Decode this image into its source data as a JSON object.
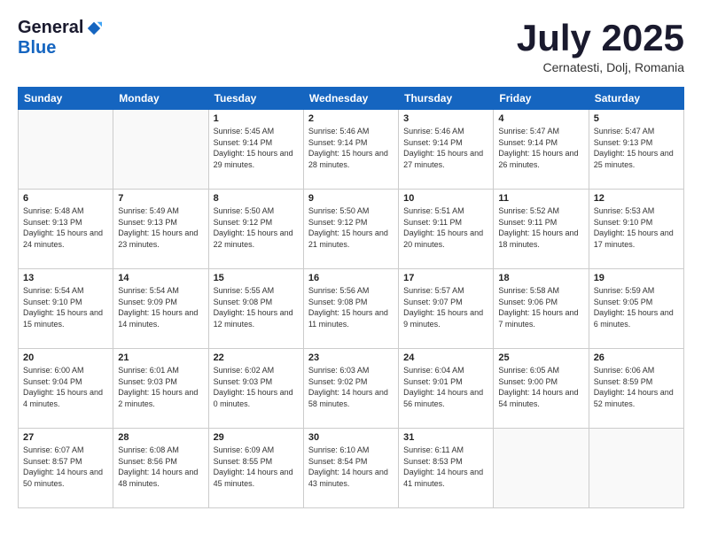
{
  "logo": {
    "general": "General",
    "blue": "Blue"
  },
  "title": "July 2025",
  "location": "Cernatesti, Dolj, Romania",
  "days_of_week": [
    "Sunday",
    "Monday",
    "Tuesday",
    "Wednesday",
    "Thursday",
    "Friday",
    "Saturday"
  ],
  "weeks": [
    [
      {
        "day": "",
        "info": ""
      },
      {
        "day": "",
        "info": ""
      },
      {
        "day": "1",
        "info": "Sunrise: 5:45 AM\nSunset: 9:14 PM\nDaylight: 15 hours and 29 minutes."
      },
      {
        "day": "2",
        "info": "Sunrise: 5:46 AM\nSunset: 9:14 PM\nDaylight: 15 hours and 28 minutes."
      },
      {
        "day": "3",
        "info": "Sunrise: 5:46 AM\nSunset: 9:14 PM\nDaylight: 15 hours and 27 minutes."
      },
      {
        "day": "4",
        "info": "Sunrise: 5:47 AM\nSunset: 9:14 PM\nDaylight: 15 hours and 26 minutes."
      },
      {
        "day": "5",
        "info": "Sunrise: 5:47 AM\nSunset: 9:13 PM\nDaylight: 15 hours and 25 minutes."
      }
    ],
    [
      {
        "day": "6",
        "info": "Sunrise: 5:48 AM\nSunset: 9:13 PM\nDaylight: 15 hours and 24 minutes."
      },
      {
        "day": "7",
        "info": "Sunrise: 5:49 AM\nSunset: 9:13 PM\nDaylight: 15 hours and 23 minutes."
      },
      {
        "day": "8",
        "info": "Sunrise: 5:50 AM\nSunset: 9:12 PM\nDaylight: 15 hours and 22 minutes."
      },
      {
        "day": "9",
        "info": "Sunrise: 5:50 AM\nSunset: 9:12 PM\nDaylight: 15 hours and 21 minutes."
      },
      {
        "day": "10",
        "info": "Sunrise: 5:51 AM\nSunset: 9:11 PM\nDaylight: 15 hours and 20 minutes."
      },
      {
        "day": "11",
        "info": "Sunrise: 5:52 AM\nSunset: 9:11 PM\nDaylight: 15 hours and 18 minutes."
      },
      {
        "day": "12",
        "info": "Sunrise: 5:53 AM\nSunset: 9:10 PM\nDaylight: 15 hours and 17 minutes."
      }
    ],
    [
      {
        "day": "13",
        "info": "Sunrise: 5:54 AM\nSunset: 9:10 PM\nDaylight: 15 hours and 15 minutes."
      },
      {
        "day": "14",
        "info": "Sunrise: 5:54 AM\nSunset: 9:09 PM\nDaylight: 15 hours and 14 minutes."
      },
      {
        "day": "15",
        "info": "Sunrise: 5:55 AM\nSunset: 9:08 PM\nDaylight: 15 hours and 12 minutes."
      },
      {
        "day": "16",
        "info": "Sunrise: 5:56 AM\nSunset: 9:08 PM\nDaylight: 15 hours and 11 minutes."
      },
      {
        "day": "17",
        "info": "Sunrise: 5:57 AM\nSunset: 9:07 PM\nDaylight: 15 hours and 9 minutes."
      },
      {
        "day": "18",
        "info": "Sunrise: 5:58 AM\nSunset: 9:06 PM\nDaylight: 15 hours and 7 minutes."
      },
      {
        "day": "19",
        "info": "Sunrise: 5:59 AM\nSunset: 9:05 PM\nDaylight: 15 hours and 6 minutes."
      }
    ],
    [
      {
        "day": "20",
        "info": "Sunrise: 6:00 AM\nSunset: 9:04 PM\nDaylight: 15 hours and 4 minutes."
      },
      {
        "day": "21",
        "info": "Sunrise: 6:01 AM\nSunset: 9:03 PM\nDaylight: 15 hours and 2 minutes."
      },
      {
        "day": "22",
        "info": "Sunrise: 6:02 AM\nSunset: 9:03 PM\nDaylight: 15 hours and 0 minutes."
      },
      {
        "day": "23",
        "info": "Sunrise: 6:03 AM\nSunset: 9:02 PM\nDaylight: 14 hours and 58 minutes."
      },
      {
        "day": "24",
        "info": "Sunrise: 6:04 AM\nSunset: 9:01 PM\nDaylight: 14 hours and 56 minutes."
      },
      {
        "day": "25",
        "info": "Sunrise: 6:05 AM\nSunset: 9:00 PM\nDaylight: 14 hours and 54 minutes."
      },
      {
        "day": "26",
        "info": "Sunrise: 6:06 AM\nSunset: 8:59 PM\nDaylight: 14 hours and 52 minutes."
      }
    ],
    [
      {
        "day": "27",
        "info": "Sunrise: 6:07 AM\nSunset: 8:57 PM\nDaylight: 14 hours and 50 minutes."
      },
      {
        "day": "28",
        "info": "Sunrise: 6:08 AM\nSunset: 8:56 PM\nDaylight: 14 hours and 48 minutes."
      },
      {
        "day": "29",
        "info": "Sunrise: 6:09 AM\nSunset: 8:55 PM\nDaylight: 14 hours and 45 minutes."
      },
      {
        "day": "30",
        "info": "Sunrise: 6:10 AM\nSunset: 8:54 PM\nDaylight: 14 hours and 43 minutes."
      },
      {
        "day": "31",
        "info": "Sunrise: 6:11 AM\nSunset: 8:53 PM\nDaylight: 14 hours and 41 minutes."
      },
      {
        "day": "",
        "info": ""
      },
      {
        "day": "",
        "info": ""
      }
    ]
  ]
}
